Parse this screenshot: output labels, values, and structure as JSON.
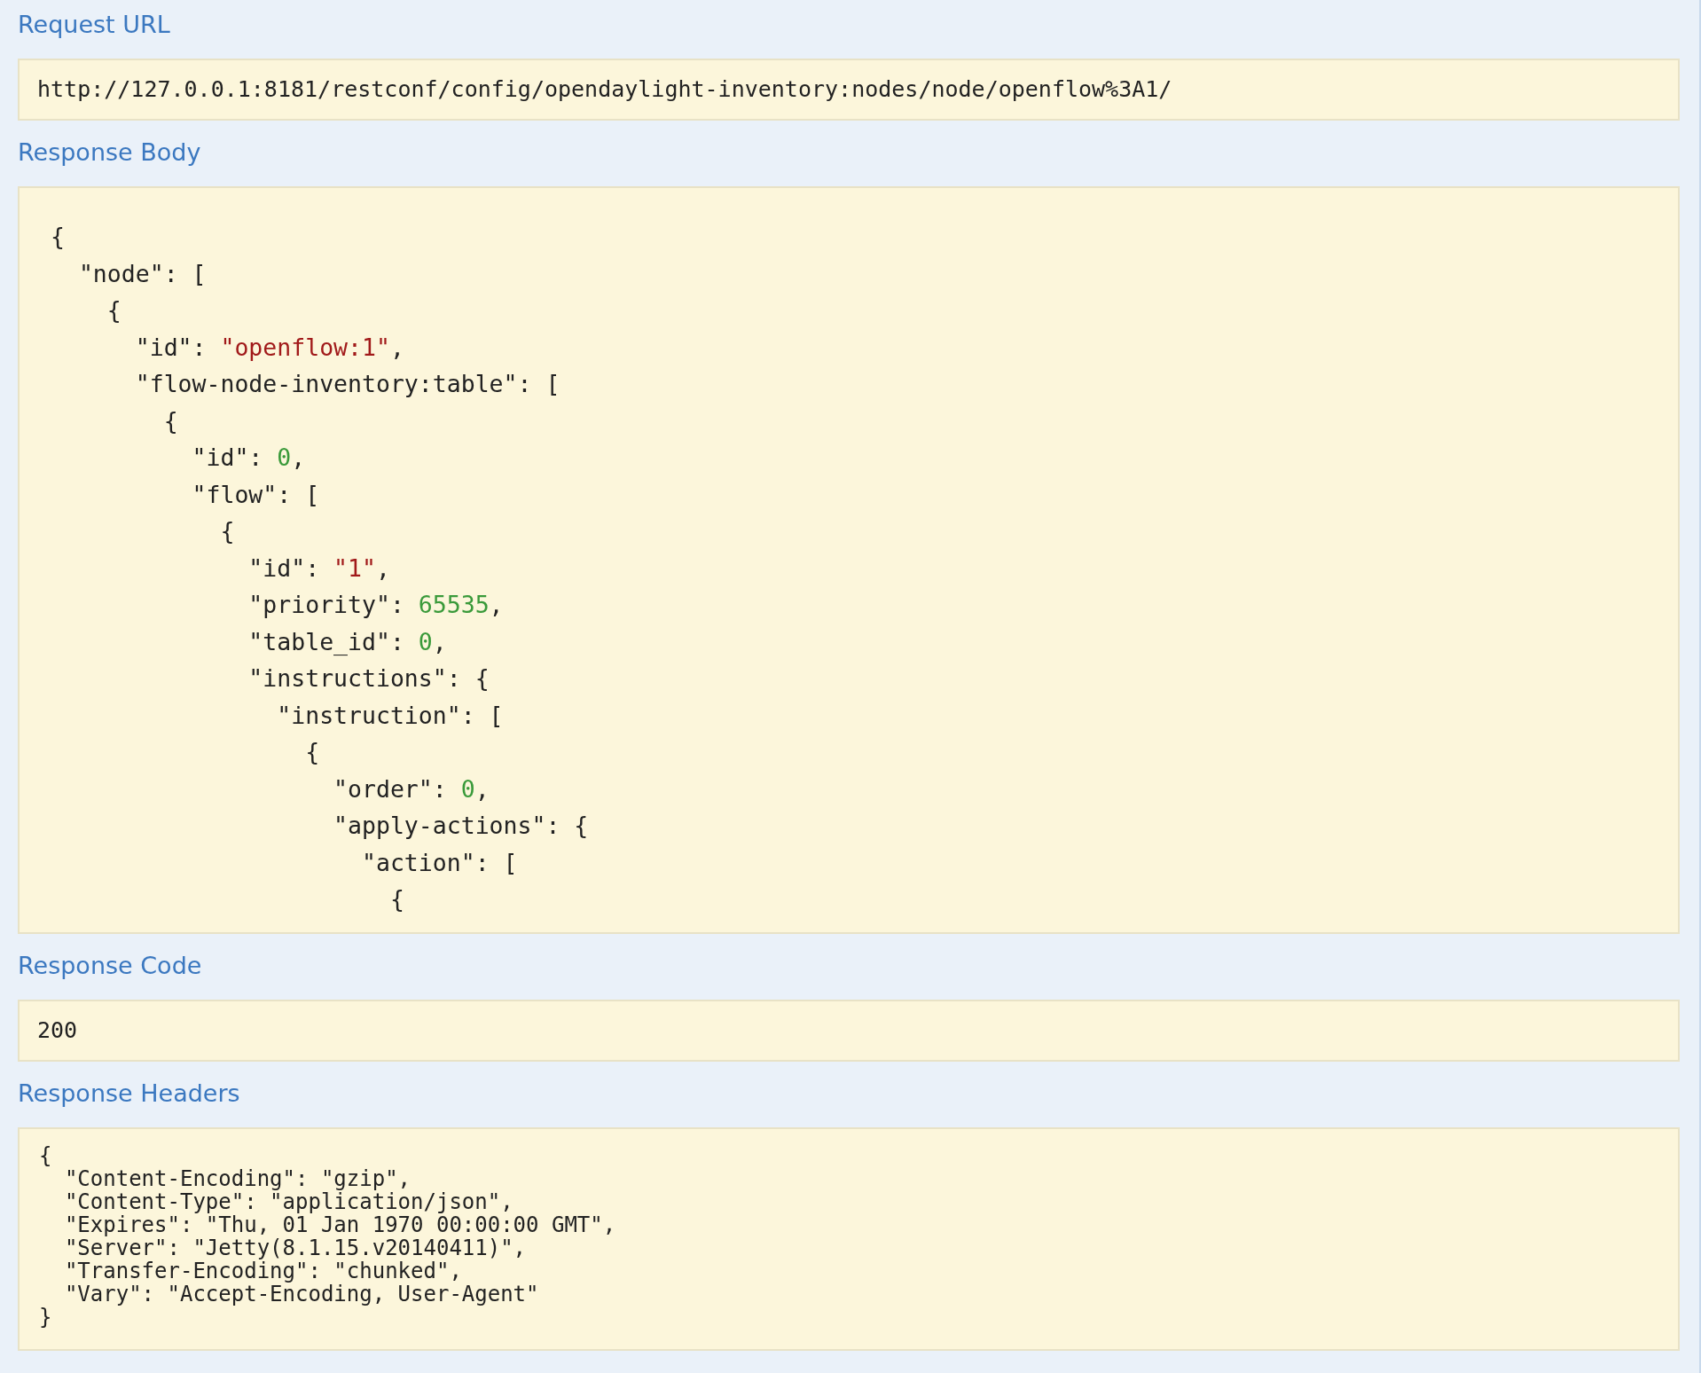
{
  "sections": [
    {
      "heading": "Request URL",
      "kind": "single",
      "value": "http://127.0.0.1:8181/restconf/config/opendaylight-inventory:nodes/node/openflow%3A1/"
    },
    {
      "heading": "Response Body",
      "kind": "code",
      "lines": [
        [
          {
            "kind": "plain",
            "text": "{"
          }
        ],
        [
          {
            "kind": "plain",
            "text": "  \"node\": ["
          }
        ],
        [
          {
            "kind": "plain",
            "text": "    {"
          }
        ],
        [
          {
            "kind": "plain",
            "text": "      \"id\": "
          },
          {
            "kind": "string",
            "text": "\"openflow:1\""
          },
          {
            "kind": "plain",
            "text": ","
          }
        ],
        [
          {
            "kind": "plain",
            "text": "      \"flow-node-inventory:table\": ["
          }
        ],
        [
          {
            "kind": "plain",
            "text": "        {"
          }
        ],
        [
          {
            "kind": "plain",
            "text": "          \"id\": "
          },
          {
            "kind": "number",
            "text": "0"
          },
          {
            "kind": "plain",
            "text": ","
          }
        ],
        [
          {
            "kind": "plain",
            "text": "          \"flow\": ["
          }
        ],
        [
          {
            "kind": "plain",
            "text": "            {"
          }
        ],
        [
          {
            "kind": "plain",
            "text": "              \"id\": "
          },
          {
            "kind": "string",
            "text": "\"1\""
          },
          {
            "kind": "plain",
            "text": ","
          }
        ],
        [
          {
            "kind": "plain",
            "text": "              \"priority\": "
          },
          {
            "kind": "number",
            "text": "65535"
          },
          {
            "kind": "plain",
            "text": ","
          }
        ],
        [
          {
            "kind": "plain",
            "text": "              \"table_id\": "
          },
          {
            "kind": "number",
            "text": "0"
          },
          {
            "kind": "plain",
            "text": ","
          }
        ],
        [
          {
            "kind": "plain",
            "text": "              \"instructions\": {"
          }
        ],
        [
          {
            "kind": "plain",
            "text": "                \"instruction\": ["
          }
        ],
        [
          {
            "kind": "plain",
            "text": "                  {"
          }
        ],
        [
          {
            "kind": "plain",
            "text": "                    \"order\": "
          },
          {
            "kind": "number",
            "text": "0"
          },
          {
            "kind": "plain",
            "text": ","
          }
        ],
        [
          {
            "kind": "plain",
            "text": "                    \"apply-actions\": {"
          }
        ],
        [
          {
            "kind": "plain",
            "text": "                      \"action\": ["
          }
        ],
        [
          {
            "kind": "plain",
            "text": "                        {"
          }
        ]
      ]
    },
    {
      "heading": "Response Code",
      "kind": "single",
      "value": "200"
    },
    {
      "heading": "Response Headers",
      "kind": "headers",
      "lines": [
        "{",
        "  \"Content-Encoding\": \"gzip\",",
        "  \"Content-Type\": \"application/json\",",
        "  \"Expires\": \"Thu, 01 Jan 1970 00:00:00 GMT\",",
        "  \"Server\": \"Jetty(8.1.15.v20140411)\",",
        "  \"Transfer-Encoding\": \"chunked\",",
        "  \"Vary\": \"Accept-Encoding, User-Agent\"",
        "}"
      ]
    }
  ]
}
